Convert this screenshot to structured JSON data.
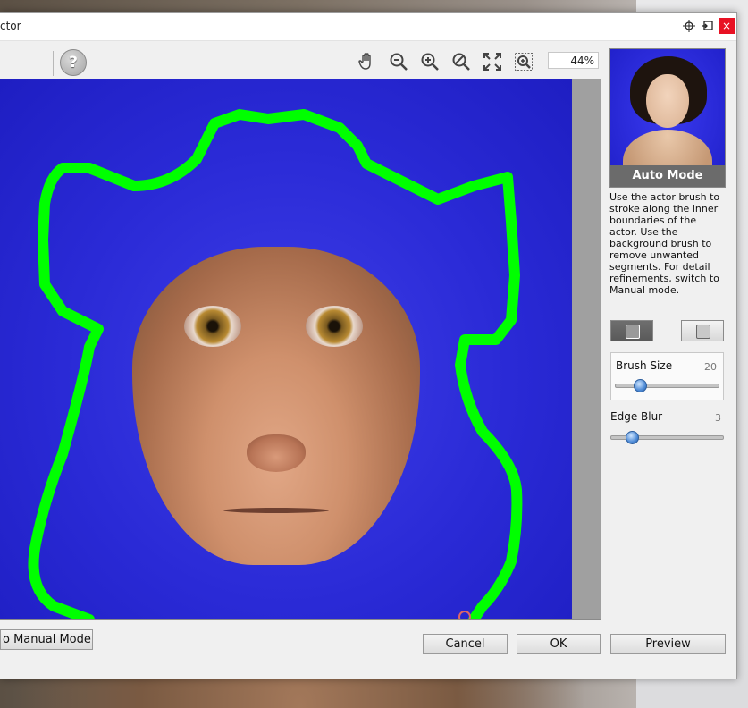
{
  "window": {
    "title": "ctor",
    "pin_icon": "crosshair-icon",
    "restore_icon": "window-restore-icon",
    "close_label": "×"
  },
  "toolbar": {
    "help_label": "?",
    "tools": [
      "hand-icon",
      "zoom-out-icon",
      "zoom-in-icon",
      "zoom-reset-icon",
      "fit-screen-icon",
      "actual-size-icon"
    ],
    "zoom_value": "44%"
  },
  "sidebar": {
    "mode_label": "Auto Mode",
    "help_text": "Use the actor brush to stroke along the inner boundaries of the actor. Use the background brush to remove unwanted segments. For detail refinements, switch to Manual mode.",
    "brush_size": {
      "label": "Brush Size",
      "value": "20",
      "level": 0.2
    },
    "edge_blur": {
      "label": "Edge Blur",
      "value": "3",
      "level": 0.15
    }
  },
  "buttons": {
    "manual_mode": "o Manual Mode",
    "cancel": "Cancel",
    "ok": "OK",
    "preview": "Preview"
  },
  "colors": {
    "selection_stroke": "#00ff00",
    "background_fill": "#2a2ad6",
    "close_button": "#e81123"
  }
}
